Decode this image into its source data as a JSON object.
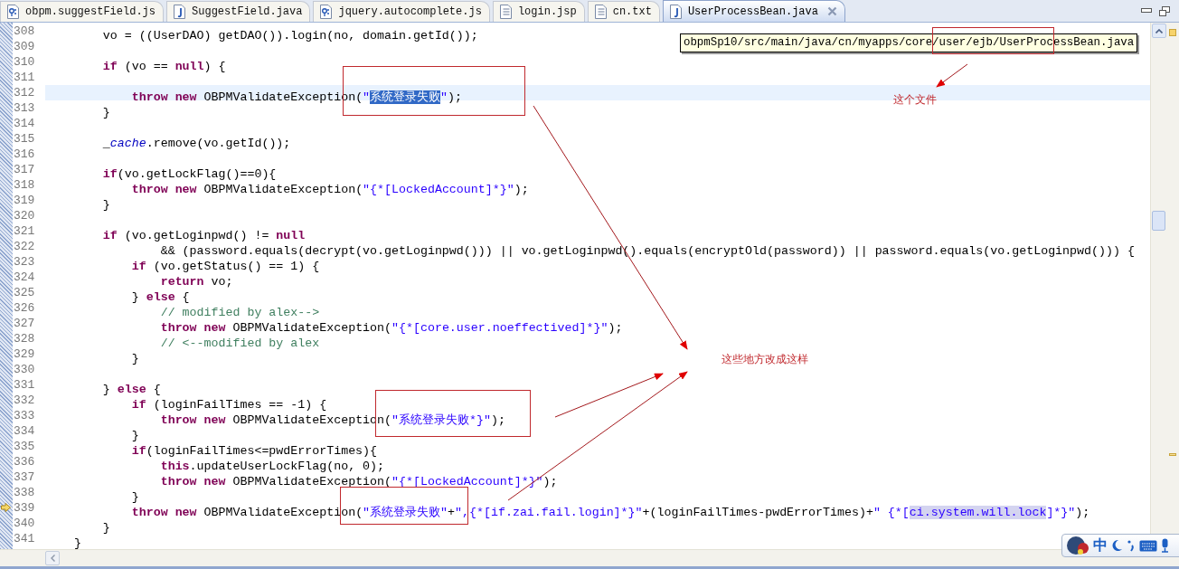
{
  "tabs": [
    {
      "label": "obpm.suggestField.js",
      "kind": "js",
      "selected": false
    },
    {
      "label": "SuggestField.java",
      "kind": "java",
      "selected": false
    },
    {
      "label": "jquery.autocomplete.js",
      "kind": "js",
      "selected": false
    },
    {
      "label": "login.jsp",
      "kind": "txt",
      "selected": false
    },
    {
      "label": "cn.txt",
      "kind": "txt",
      "selected": false
    },
    {
      "label": "UserProcessBean.java",
      "kind": "java",
      "selected": true
    }
  ],
  "tooltip": "obpmSp10/src/main/java/cn/myapps/core/user/ejb/UserProcessBean.java",
  "lines": [
    {
      "number": "308",
      "tokens": [
        {
          "kind": "plain",
          "text": "        vo = ((UserDAO) getDAO()).login(no, domain.getId());"
        }
      ]
    },
    {
      "number": "309"
    },
    {
      "number": "310",
      "tokens": [
        {
          "kind": "kw",
          "text": "        if"
        },
        {
          "kind": "plain",
          "text": " (vo == "
        },
        {
          "kind": "kw",
          "text": "null"
        },
        {
          "kind": "plain",
          "text": ") {"
        }
      ]
    },
    {
      "number": "311"
    },
    {
      "number": "312",
      "current": true,
      "tokens": [
        {
          "kind": "kw",
          "text": "            throw new"
        },
        {
          "kind": "plain",
          "text": " OBPMValidateException("
        },
        {
          "kind": "str",
          "text": "\""
        },
        {
          "kind": "selection",
          "text": "系统登录失败"
        },
        {
          "kind": "str",
          "text": "\""
        },
        {
          "kind": "plain",
          "text": ");"
        }
      ]
    },
    {
      "number": "313",
      "tokens": [
        {
          "kind": "plain",
          "text": "        }"
        }
      ]
    },
    {
      "number": "314"
    },
    {
      "number": "315",
      "tokens": [
        {
          "kind": "plain",
          "text": "        _"
        },
        {
          "kind": "italic",
          "text": "cache"
        },
        {
          "kind": "plain",
          "text": ".remove(vo.getId());"
        }
      ]
    },
    {
      "number": "316"
    },
    {
      "number": "317",
      "tokens": [
        {
          "kind": "kw",
          "text": "        if"
        },
        {
          "kind": "plain",
          "text": "(vo.getLockFlag()==0){"
        }
      ]
    },
    {
      "number": "318",
      "tokens": [
        {
          "kind": "kw",
          "text": "            throw new"
        },
        {
          "kind": "plain",
          "text": " OBPMValidateException("
        },
        {
          "kind": "str",
          "text": "\"{*[LockedAccount]*}\""
        },
        {
          "kind": "plain",
          "text": ");"
        }
      ]
    },
    {
      "number": "319",
      "tokens": [
        {
          "kind": "plain",
          "text": "        }"
        }
      ]
    },
    {
      "number": "320"
    },
    {
      "number": "321",
      "tokens": [
        {
          "kind": "kw",
          "text": "        if"
        },
        {
          "kind": "plain",
          "text": " (vo.getLoginpwd() != "
        },
        {
          "kind": "kw",
          "text": "null"
        }
      ]
    },
    {
      "number": "322",
      "tokens": [
        {
          "kind": "plain",
          "text": "                && (password.equals(decrypt(vo.getLoginpwd())) || vo.getLoginpwd().equals(encryptOld(password)) || password.equals(vo.getLoginpwd())) {"
        }
      ]
    },
    {
      "number": "323",
      "tokens": [
        {
          "kind": "kw",
          "text": "            if"
        },
        {
          "kind": "plain",
          "text": " (vo.getStatus() == 1) {"
        }
      ]
    },
    {
      "number": "324",
      "tokens": [
        {
          "kind": "kw",
          "text": "                return"
        },
        {
          "kind": "plain",
          "text": " vo;"
        }
      ]
    },
    {
      "number": "325",
      "tokens": [
        {
          "kind": "plain",
          "text": "            } "
        },
        {
          "kind": "kw",
          "text": "else"
        },
        {
          "kind": "plain",
          "text": " {"
        }
      ]
    },
    {
      "number": "326",
      "tokens": [
        {
          "kind": "comment",
          "text": "                // modified by alex-->"
        }
      ]
    },
    {
      "number": "327",
      "tokens": [
        {
          "kind": "kw",
          "text": "                throw new"
        },
        {
          "kind": "plain",
          "text": " OBPMValidateException("
        },
        {
          "kind": "str",
          "text": "\"{*[core.user.noeffectived]*}\""
        },
        {
          "kind": "plain",
          "text": ");"
        }
      ]
    },
    {
      "number": "328",
      "tokens": [
        {
          "kind": "comment",
          "text": "                // <--modified by alex"
        }
      ]
    },
    {
      "number": "329",
      "tokens": [
        {
          "kind": "plain",
          "text": "            }"
        }
      ]
    },
    {
      "number": "330"
    },
    {
      "number": "331",
      "tokens": [
        {
          "kind": "plain",
          "text": "        } "
        },
        {
          "kind": "kw",
          "text": "else"
        },
        {
          "kind": "plain",
          "text": " {"
        }
      ]
    },
    {
      "number": "332",
      "tokens": [
        {
          "kind": "kw",
          "text": "            if"
        },
        {
          "kind": "plain",
          "text": " (loginFailTimes == -1) {"
        }
      ]
    },
    {
      "number": "333",
      "tokens": [
        {
          "kind": "kw",
          "text": "                throw new"
        },
        {
          "kind": "plain",
          "text": " OBPMValidateException("
        },
        {
          "kind": "str",
          "text": "\"系统登录失败*}\""
        },
        {
          "kind": "plain",
          "text": ");"
        }
      ]
    },
    {
      "number": "334",
      "tokens": [
        {
          "kind": "plain",
          "text": "            }"
        }
      ]
    },
    {
      "number": "335",
      "tokens": [
        {
          "kind": "kw",
          "text": "            if"
        },
        {
          "kind": "plain",
          "text": "(loginFailTimes<=pwdErrorTimes){"
        }
      ]
    },
    {
      "number": "336",
      "tokens": [
        {
          "kind": "kw",
          "text": "                this"
        },
        {
          "kind": "plain",
          "text": ".updateUserLockFlag(no, 0);"
        }
      ]
    },
    {
      "number": "337",
      "tokens": [
        {
          "kind": "kw",
          "text": "                throw new"
        },
        {
          "kind": "plain",
          "text": " OBPMValidateException("
        },
        {
          "kind": "str",
          "text": "\"{*[LockedAccount]*}\""
        },
        {
          "kind": "plain",
          "text": ");"
        }
      ]
    },
    {
      "number": "338",
      "tokens": [
        {
          "kind": "plain",
          "text": "            }"
        }
      ]
    },
    {
      "number": "339",
      "marked": true,
      "tokens": [
        {
          "kind": "kw",
          "text": "            throw new"
        },
        {
          "kind": "plain",
          "text": " OBPMValidateException("
        },
        {
          "kind": "str",
          "text": "\"系统登录失败\""
        },
        {
          "kind": "plain",
          "text": "+"
        },
        {
          "kind": "str",
          "text": "\",{*[if.zai.fail.login]*}\""
        },
        {
          "kind": "plain",
          "text": "+(loginFailTimes-pwdErrorTimes)+"
        },
        {
          "kind": "str",
          "text": "\" {*["
        },
        {
          "kind": "occurrence",
          "text": "ci.system.will.lock"
        },
        {
          "kind": "str",
          "text": "]*}\""
        },
        {
          "kind": "plain",
          "text": ");"
        }
      ]
    },
    {
      "number": "340",
      "tokens": [
        {
          "kind": "plain",
          "text": "        }"
        }
      ]
    },
    {
      "number": "341",
      "tokens": [
        {
          "kind": "plain",
          "text": "    }"
        }
      ]
    }
  ],
  "notes": [
    "这个文件",
    "这些地方改成这样"
  ],
  "ime_bar": {
    "mode": "中"
  }
}
